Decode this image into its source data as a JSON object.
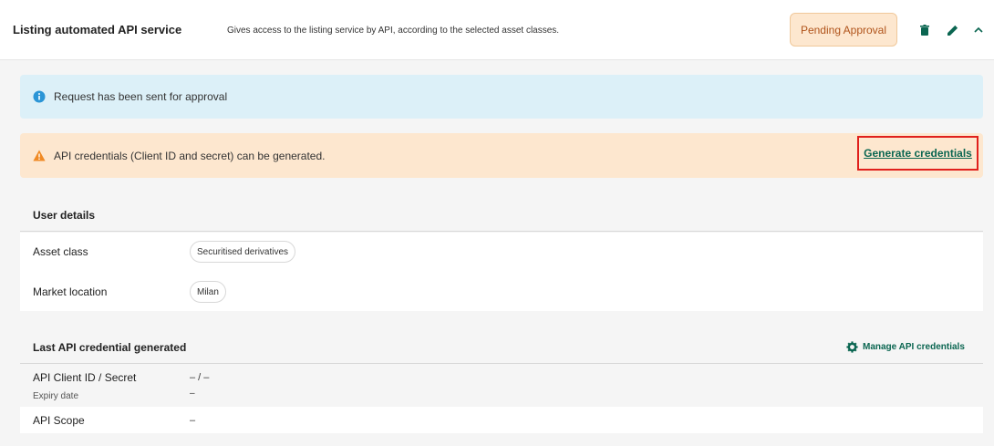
{
  "header": {
    "title": "Listing automated API service",
    "description": "Gives access to the listing service by API, according to the selected asset classes.",
    "status": "Pending Approval",
    "icons": [
      "trash-icon",
      "pencil-icon",
      "chevron-up-icon"
    ]
  },
  "alerts": {
    "info": "Request has been sent for approval",
    "warning": "API credentials (Client ID and secret) can be generated.",
    "generate_link": "Generate credentials"
  },
  "user_details": {
    "heading": "User details",
    "asset_class_label": "Asset class",
    "asset_class_value": "Securitised derivatives",
    "market_location_label": "Market location",
    "market_location_value": "Milan"
  },
  "api_credentials": {
    "heading": "Last API credential generated",
    "manage_label": "Manage API credentials",
    "client_label": "API Client ID / Secret",
    "client_value": "– / –",
    "expiry_label": "Expiry date",
    "expiry_value": "–",
    "scope_label": "API Scope",
    "scope_value": "–"
  },
  "colors": {
    "accent": "#0b6651",
    "pending_bg": "#fde7cf",
    "pending_text": "#b0531a",
    "info_bg": "#dcf0f8",
    "highlight_border": "#e0201c"
  }
}
